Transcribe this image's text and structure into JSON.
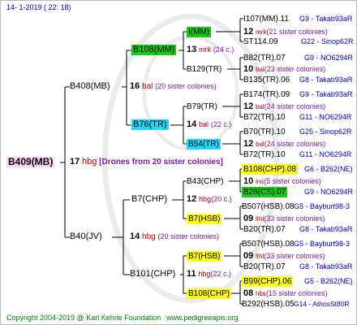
{
  "header": {
    "date": "14-  1-2019 (  22:  18)"
  },
  "root": {
    "name": "B409(MB)",
    "num": "17",
    "var": "hbg",
    "drones": "[Drones from 20 sister colonies]"
  },
  "gen1": [
    {
      "name": "B408(MB)",
      "num": "16",
      "var": "bal",
      "sis": "(20 sister colonies)"
    },
    {
      "name": "B40(JV)",
      "num": "14",
      "var": "hbg",
      "sis": "(20 sister colonies)"
    }
  ],
  "gen2": [
    {
      "name": "B108(MM)",
      "num": "13",
      "var": "mrk",
      "sis": "(24 c.)"
    },
    {
      "name": "B76(TR)",
      "num": "14",
      "var": "bal",
      "sis": "(22 c.)"
    },
    {
      "name": "B7(CHP)",
      "num": "12",
      "var": "hbg",
      "sis": "(20 c.)"
    },
    {
      "name": "B101(CHP)",
      "num": "11",
      "var": "hbg",
      "sis": "(22 c.)"
    }
  ],
  "gen3": [
    {
      "name": "I(MM)",
      "num": "12",
      "var": "mrk",
      "sis": "(21 sister colonies)"
    },
    {
      "name": "B129(TR)",
      "num": "10",
      "var": "bal",
      "sis": "(23 sister colonies)"
    },
    {
      "name": "B79(TR)",
      "num": "12",
      "var": "bal",
      "sis": "(24 sister colonies)"
    },
    {
      "name": "B54(TR)",
      "num": "12",
      "var": "bal",
      "sis": "(24 sister colonies)"
    },
    {
      "name": "B43(CHP)",
      "num": "10",
      "var": "ins",
      "sis": "(5 sister colonies)"
    },
    {
      "name": "B7(HSB)",
      "num": "09",
      "var": "lthl",
      "sis": "(33 sister colonies)"
    },
    {
      "name": "B7(HSB)",
      "num": "09",
      "var": "lthl",
      "sis": "(33 sister colonies)"
    },
    {
      "name": "B108(CHP)",
      "num": "08",
      "var": "hbs",
      "sis": "(15 sister colonies)"
    }
  ],
  "gen4": [
    {
      "name": "I107(MM).11",
      "ref": "G9 - Takab93aR"
    },
    {
      "name": "ST114.09",
      "ref": "G22 - Sinop62R"
    },
    {
      "name": "B82(TR).07",
      "ref": "G9 - NO6294R"
    },
    {
      "name": "B135(TR).06",
      "ref": "G8 - Takab93aR"
    },
    {
      "name": "B174(TR).09",
      "ref": "G9 - Takab93aR"
    },
    {
      "name": "B72(TR).10",
      "ref": "G11 - NO6294R"
    },
    {
      "name": "B70(TR).10",
      "ref": "G25 - Sinop62R"
    },
    {
      "name": "B72(TR).10",
      "ref": "G11 - NO6294R"
    },
    {
      "name": "B108(CHP).08",
      "ref": "G6 - B262(NE)"
    },
    {
      "name": "B26(CS).07",
      "ref": "G9 - NO6294R"
    },
    {
      "name": "B507(HSB).08",
      "ref": "G5 - Bayburt98-3"
    },
    {
      "name": "B20(TR).07",
      "ref": "G8 - Takab93aR"
    },
    {
      "name": "B507(HSB).08",
      "ref": "G5 - Bayburt98-3"
    },
    {
      "name": "B20(TR).07",
      "ref": "G8 - Takab93aR"
    },
    {
      "name": "B99(CHP).06",
      "ref": "G5 - B262(NE)"
    },
    {
      "name": "B292(HSB).05",
      "ref": "G14 - AthosSt80R"
    }
  ],
  "footer": {
    "copyright": "Copyright 2004-2019 @ Karl Kehrle Foundation",
    "site": "www.pedigreeapis.org"
  },
  "colors": {
    "green": "#19c719",
    "yellow": "#ffff19",
    "cyan": "#22d7ff",
    "pink": "#ffd2f5",
    "lines": "#000000"
  }
}
